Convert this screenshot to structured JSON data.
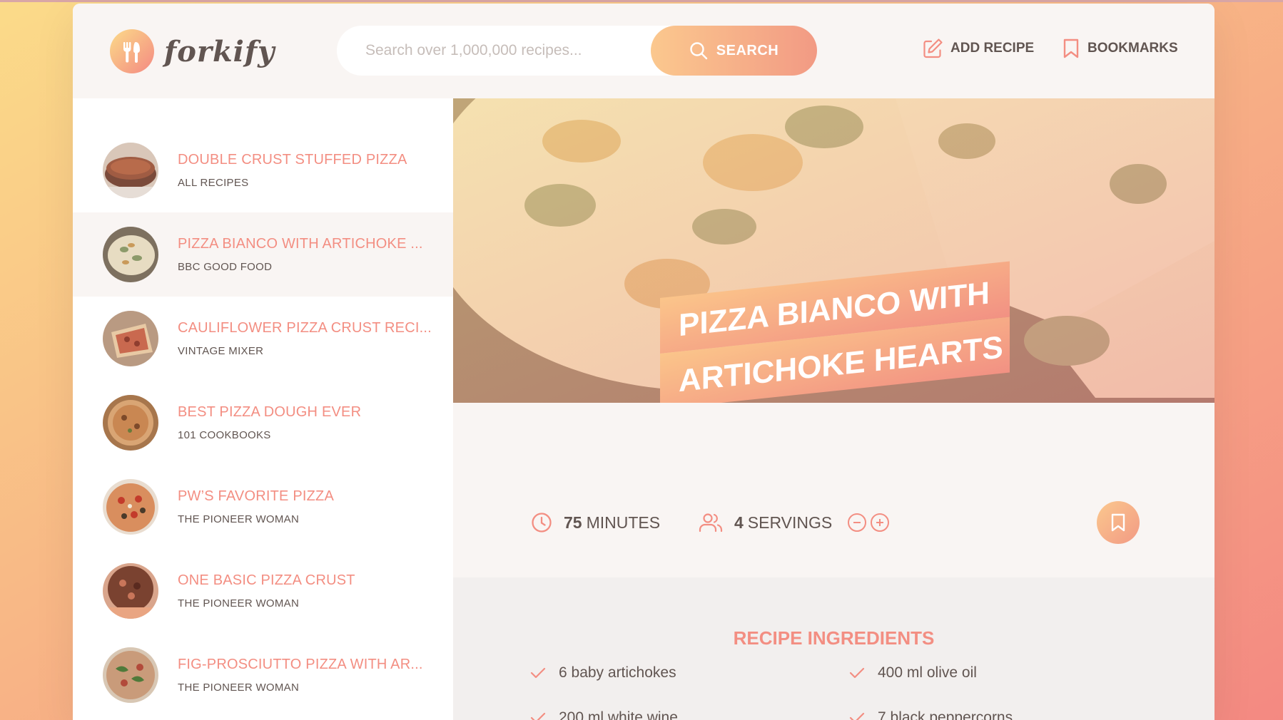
{
  "header": {
    "logo_text": "forkify",
    "search_placeholder": "Search over 1,000,000 recipes...",
    "search_label": "SEARCH",
    "add_recipe_label": "ADD RECIPE",
    "bookmarks_label": "BOOKMARKS"
  },
  "results": [
    {
      "title": "DOUBLE CRUST STUFFED PIZZA",
      "publisher": "ALL RECIPES",
      "active": false
    },
    {
      "title": "PIZZA BIANCO WITH ARTICHOKE ...",
      "publisher": "BBC GOOD FOOD",
      "active": true
    },
    {
      "title": "CAULIFLOWER PIZZA CRUST RECI...",
      "publisher": "VINTAGE MIXER",
      "active": false
    },
    {
      "title": "BEST PIZZA DOUGH EVER",
      "publisher": "101 COOKBOOKS",
      "active": false
    },
    {
      "title": "PW’S FAVORITE PIZZA",
      "publisher": "THE PIONEER WOMAN",
      "active": false
    },
    {
      "title": "ONE BASIC PIZZA CRUST",
      "publisher": "THE PIONEER WOMAN",
      "active": false
    },
    {
      "title": "FIG-PROSCIUTTO PIZZA WITH AR...",
      "publisher": "THE PIONEER WOMAN",
      "active": false
    }
  ],
  "recipe": {
    "title_line1": "PIZZA BIANCO WITH",
    "title_line2": "ARTICHOKE HEARTS",
    "minutes": "75",
    "minutes_unit": "MINUTES",
    "servings": "4",
    "servings_unit": "SERVINGS",
    "ingredients_heading": "RECIPE INGREDIENTS",
    "ingredients": [
      "6 baby artichokes",
      "400 ml olive oil",
      "200 ml white wine",
      "7 black peppercorns"
    ]
  },
  "colors": {
    "accent": "#f38e82",
    "gradient_start": "#fbdb89",
    "gradient_end": "#f48982",
    "text": "#615551"
  }
}
